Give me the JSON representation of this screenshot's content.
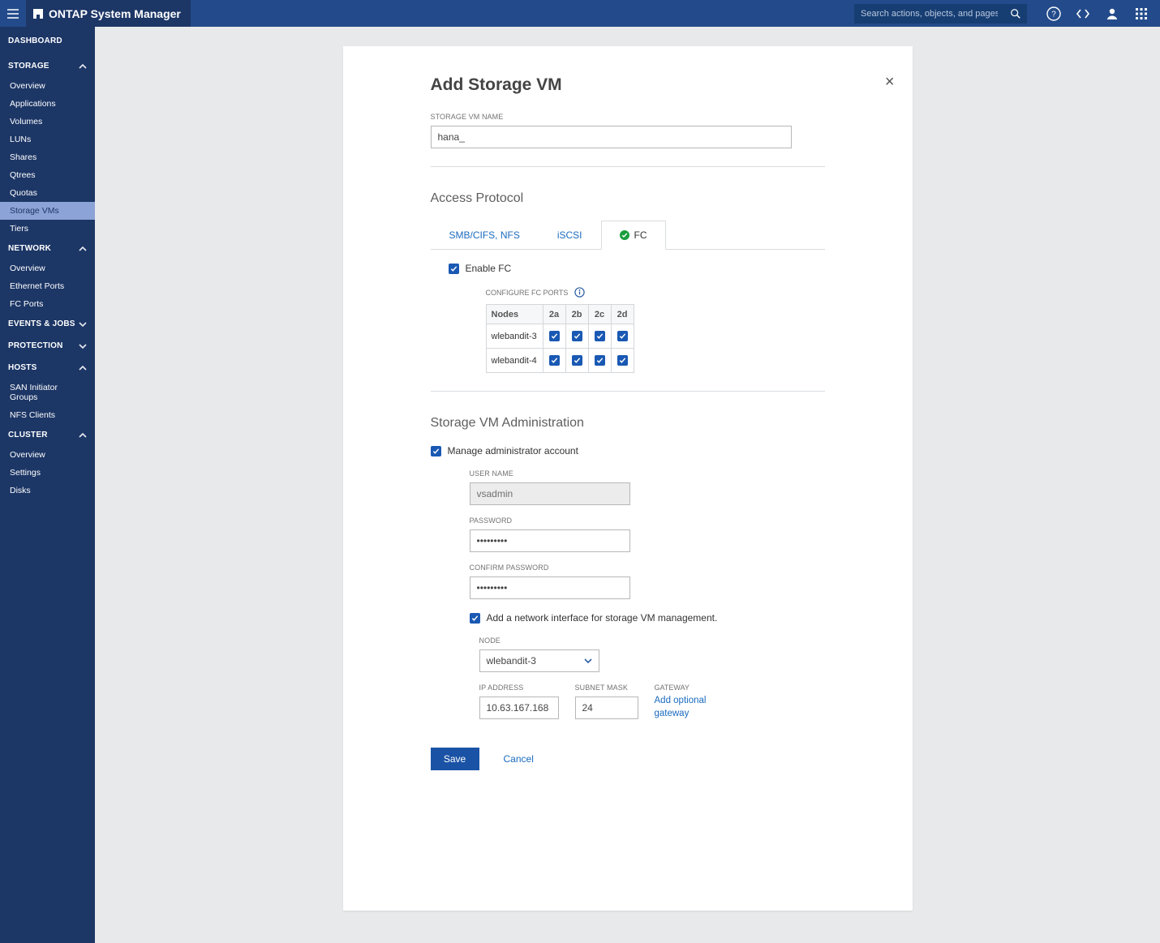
{
  "brand": "ONTAP System Manager",
  "search_placeholder": "Search actions, objects, and pages",
  "sidebar": {
    "dashboard": "DASHBOARD",
    "sections": [
      {
        "label": "STORAGE",
        "expanded": true,
        "items": [
          "Overview",
          "Applications",
          "Volumes",
          "LUNs",
          "Shares",
          "Qtrees",
          "Quotas",
          "Storage VMs",
          "Tiers"
        ],
        "active": "Storage VMs"
      },
      {
        "label": "NETWORK",
        "expanded": true,
        "items": [
          "Overview",
          "Ethernet Ports",
          "FC Ports"
        ]
      },
      {
        "label": "EVENTS & JOBS",
        "expanded": false,
        "items": []
      },
      {
        "label": "PROTECTION",
        "expanded": false,
        "items": []
      },
      {
        "label": "HOSTS",
        "expanded": true,
        "items": [
          "SAN Initiator Groups",
          "NFS Clients"
        ]
      },
      {
        "label": "CLUSTER",
        "expanded": true,
        "items": [
          "Overview",
          "Settings",
          "Disks"
        ]
      }
    ]
  },
  "form": {
    "title": "Add Storage VM",
    "name_label": "STORAGE VM NAME",
    "name_value": "hana_",
    "access_section": "Access Protocol",
    "tabs": {
      "smb": "SMB/CIFS, NFS",
      "iscsi": "iSCSI",
      "fc": "FC",
      "active": "fc"
    },
    "enable_fc": "Enable FC",
    "configure_ports": "CONFIGURE FC PORTS",
    "port_table": {
      "nodes_header": "Nodes",
      "cols": [
        "2a",
        "2b",
        "2c",
        "2d"
      ],
      "rows": [
        "wlebandit-3",
        "wlebandit-4"
      ]
    },
    "admin_section": "Storage VM Administration",
    "manage_admin": "Manage administrator account",
    "user_name_label": "USER NAME",
    "user_name_value": "vsadmin",
    "password_label": "PASSWORD",
    "confirm_password_label": "CONFIRM PASSWORD",
    "password_mask": "•••••••••",
    "add_nic": "Add a network interface for storage VM management.",
    "node_label": "NODE",
    "node_value": "wlebandit-3",
    "ip_label": "IP ADDRESS",
    "ip_value": "10.63.167.168",
    "mask_label": "SUBNET MASK",
    "mask_value": "24",
    "gateway_label": "GATEWAY",
    "gateway_link": "Add optional gateway",
    "save": "Save",
    "cancel": "Cancel"
  }
}
